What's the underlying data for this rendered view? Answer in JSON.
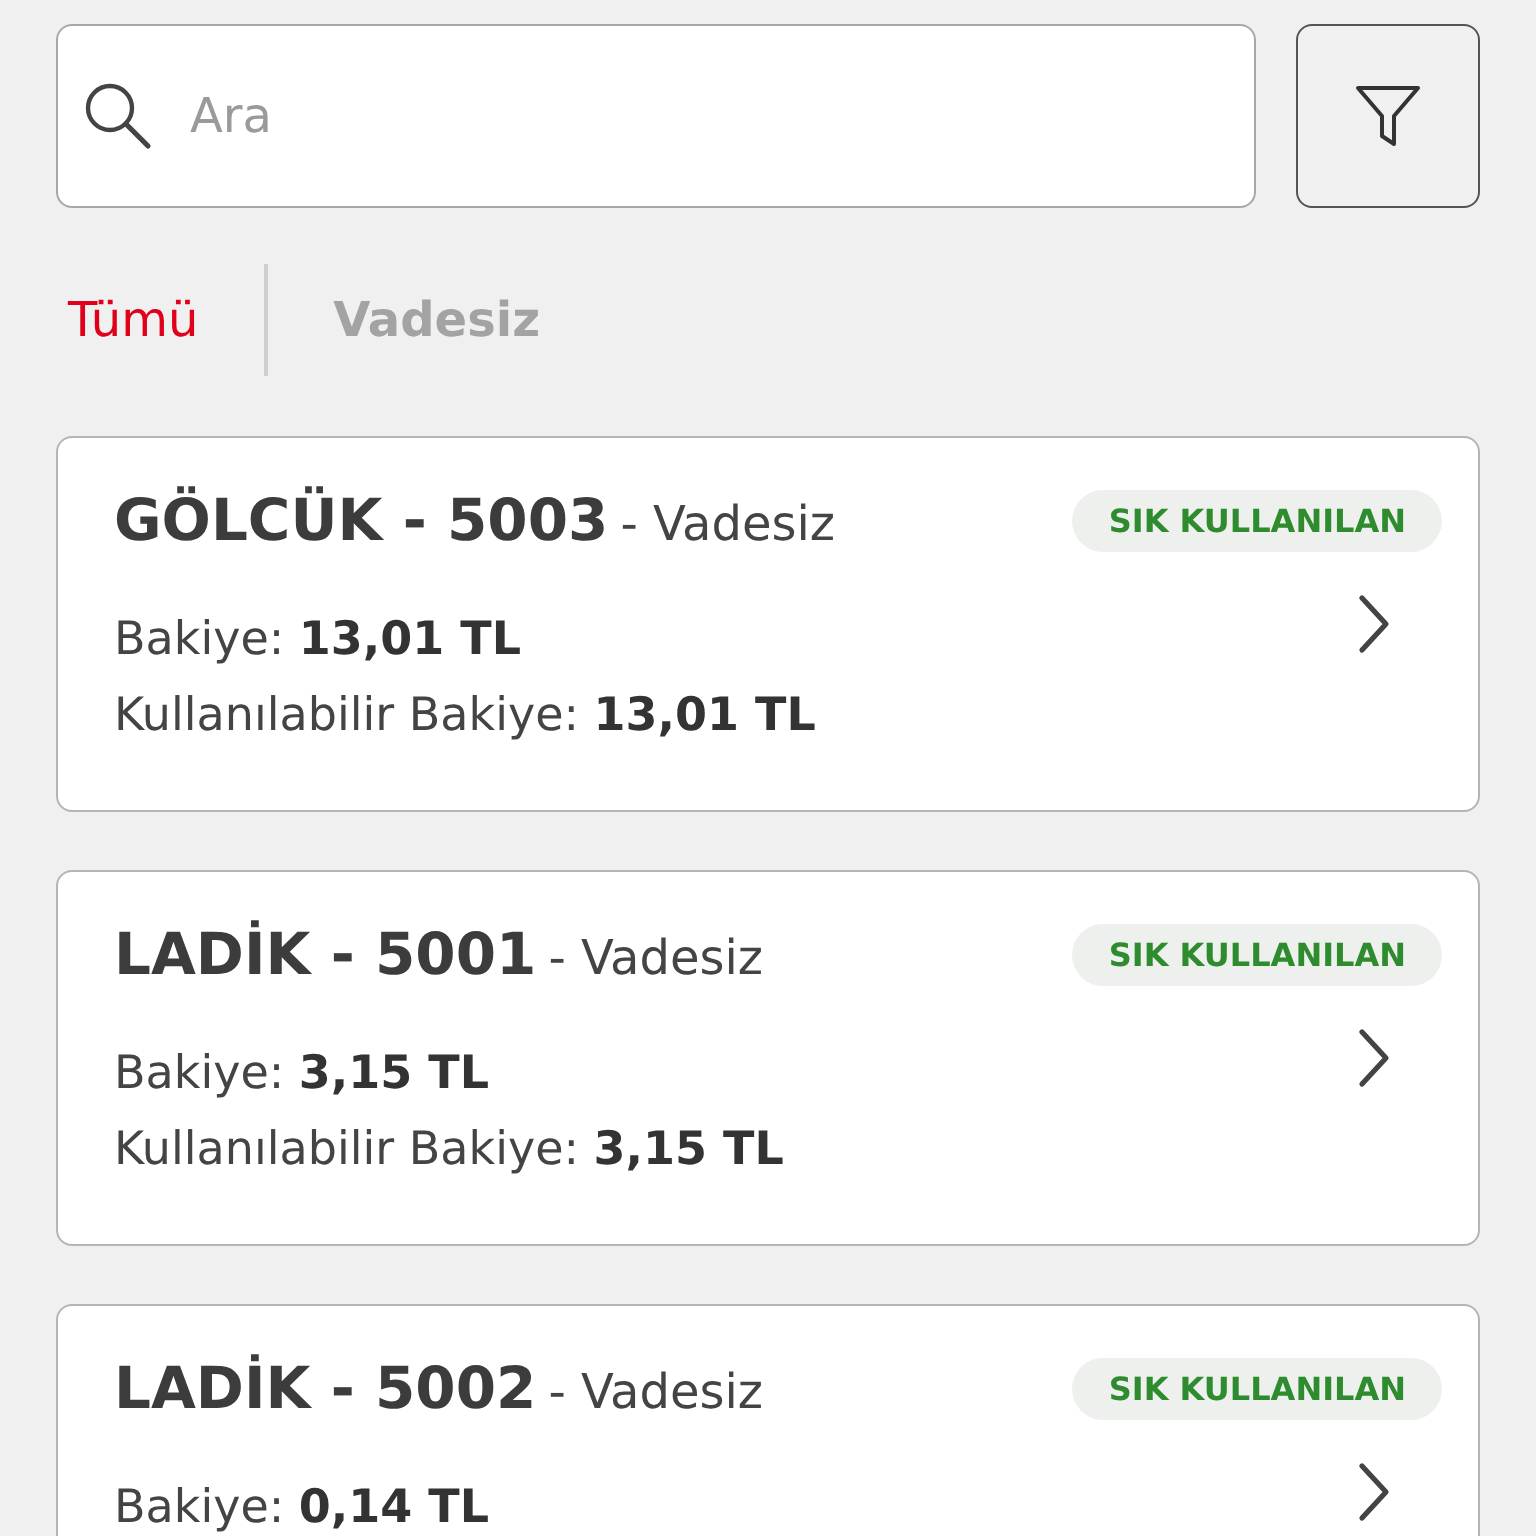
{
  "search": {
    "placeholder": "Ara"
  },
  "tabs": [
    {
      "label": "Tümü",
      "selected": true
    },
    {
      "label": "Vadesiz",
      "selected": false
    }
  ],
  "accounts": [
    {
      "title": "GÖLCÜK - 5003",
      "type": "- Vadesiz",
      "badge": "SIK KULLANILAN",
      "balance_label": "Bakiye:",
      "balance": "13,01 TL",
      "available_label": "Kullanılabilir Bakiye:",
      "available": "13,01 TL"
    },
    {
      "title": "LADİK - 5001",
      "type": "- Vadesiz",
      "badge": "SIK KULLANILAN",
      "balance_label": "Bakiye:",
      "balance": "3,15 TL",
      "available_label": "Kullanılabilir Bakiye:",
      "available": "3,15 TL"
    },
    {
      "title": "LADİK - 5002",
      "type": "- Vadesiz",
      "badge": "SIK KULLANILAN",
      "balance_label": "Bakiye:",
      "balance": "0,14 TL"
    }
  ]
}
